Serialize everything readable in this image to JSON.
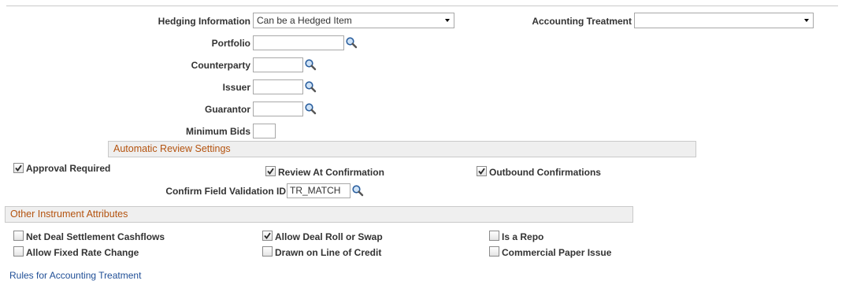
{
  "hedging": {
    "label": "Hedging Information",
    "value": "Can be a Hedged Item"
  },
  "accounting": {
    "label": "Accounting Treatment",
    "value": ""
  },
  "fields": {
    "portfolio": {
      "label": "Portfolio",
      "value": ""
    },
    "counterparty": {
      "label": "Counterparty",
      "value": ""
    },
    "issuer": {
      "label": "Issuer",
      "value": ""
    },
    "guarantor": {
      "label": "Guarantor",
      "value": ""
    },
    "minimum_bids": {
      "label": "Minimum Bids",
      "value": ""
    }
  },
  "auto_review": {
    "title": "Automatic Review Settings",
    "approval_required": {
      "label": "Approval Required",
      "checked": true
    },
    "review_at_confirmation": {
      "label": "Review At Confirmation",
      "checked": true
    },
    "outbound_confirmations": {
      "label": "Outbound Confirmations",
      "checked": true
    },
    "confirm_field_validation": {
      "label": "Confirm Field Validation ID",
      "value": "TR_MATCH"
    }
  },
  "other_attributes": {
    "title": "Other Instrument Attributes",
    "net_deal_settlement": {
      "label": "Net Deal Settlement Cashflows",
      "checked": false
    },
    "allow_fixed_rate_change": {
      "label": "Allow Fixed Rate Change",
      "checked": false
    },
    "allow_deal_roll": {
      "label": "Allow Deal Roll or Swap",
      "checked": true
    },
    "drawn_on_line_of_credit": {
      "label": "Drawn on Line of Credit",
      "checked": false
    },
    "is_a_repo": {
      "label": "Is a Repo",
      "checked": false
    },
    "commercial_paper_issue": {
      "label": "Commercial Paper Issue",
      "checked": false
    }
  },
  "links": {
    "rules_accounting": "Rules for Accounting Treatment"
  },
  "icons": {
    "search": "search-icon",
    "dropdown": "chevron-down-icon",
    "check": "check-icon"
  },
  "colors": {
    "section_title": "#b4530f",
    "link": "#1f4e96",
    "section_bg": "#efefef"
  }
}
